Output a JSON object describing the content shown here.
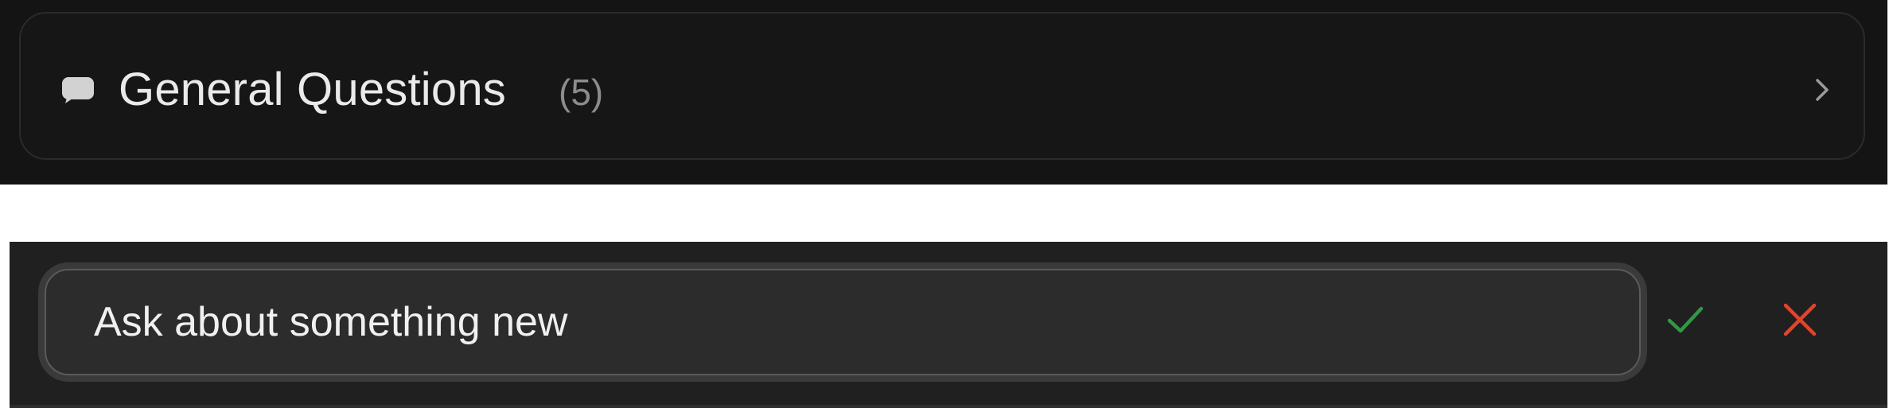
{
  "category": {
    "title": "General Questions",
    "count": "(5)",
    "icon": "chat-bubble-icon",
    "chevron_icon": "chevron-right-icon"
  },
  "new_question": {
    "value": "Ask about something new",
    "confirm_icon": "check-icon",
    "cancel_icon": "close-icon"
  },
  "colors": {
    "panel_background": "#141414",
    "title_text": "#eaeaea",
    "count_text": "#8c8c8c",
    "confirm": "#2f9a43",
    "cancel": "#e0442c"
  }
}
